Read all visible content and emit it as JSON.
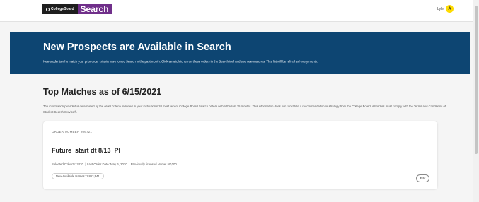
{
  "header": {
    "brand_college_board": "CollegeBoard",
    "brand_search": "Search",
    "user_name": "Lyle",
    "user_initial": "A"
  },
  "banner": {
    "title": "New Prospects are Available in Search",
    "text": "New students who match your prior order criteria have joined Search in the past month. Click a match to re-run these orders in the Search tool and see new matches. This list will be refreshed every month."
  },
  "matches": {
    "title": "Top Matches as of 6/15/2021",
    "disclaimer": "The information provided is determined by the order criteria included in your institution's 20 most recent College Board Search orders within the last 15 months. This information does not constitute a recommendation or strategy from the College Board. All orders must comply with the Terms and Conditions of Student Search Service®."
  },
  "card": {
    "order_number": "ORDER NUMBER 206721",
    "title": "Future_start dt 8/13_PI",
    "selected_cohorts": "Selected Cohorts: 2020",
    "last_order_date": "Last Order Date: May 6, 2020",
    "previously_licensed": "Previously licensed Name: 50,000",
    "new_available": "New Available Names: 1,863,941",
    "edit_label": "Edit"
  },
  "colors": {
    "banner_bg": "#0d4572",
    "brand_purple": "#702f8a",
    "avatar_yellow": "#fedb00"
  }
}
